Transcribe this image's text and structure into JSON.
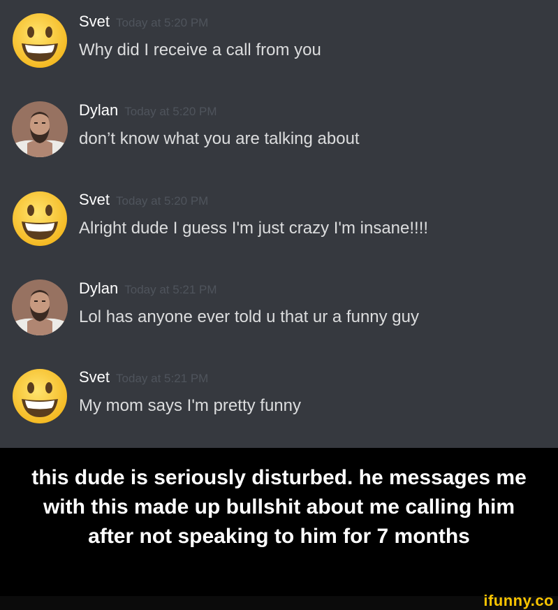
{
  "messages": [
    {
      "author": "Svet",
      "timestamp": "Today at 5:20 PM",
      "text": "Why did I receive a call from you",
      "avatar": "smiley-emoji-avatar"
    },
    {
      "author": "Dylan",
      "timestamp": "Today at 5:20 PM",
      "text": "don’t know what you are talking about",
      "avatar": "bearded-man-photo-avatar"
    },
    {
      "author": "Svet",
      "timestamp": "Today at 5:20 PM",
      "text": "Alright dude I guess I'm just crazy I'm insane!!!!",
      "avatar": "smiley-emoji-avatar"
    },
    {
      "author": "Dylan",
      "timestamp": "Today at 5:21 PM",
      "text": "Lol has anyone ever told u that ur a funny guy",
      "avatar": "bearded-man-photo-avatar"
    },
    {
      "author": "Svet",
      "timestamp": "Today at 5:21 PM",
      "text": "My mom says I'm pretty funny",
      "avatar": "smiley-emoji-avatar"
    }
  ],
  "caption": "this dude is seriously disturbed. he messages me with this made up bullshit about me calling him after not speaking to him for 7 months",
  "watermark": "ifunny.co",
  "colors": {
    "chat_background": "#36393f",
    "author_name": "#ffffff",
    "timestamp": "#4f545c",
    "message_text": "#dcddde",
    "caption_background": "#000000",
    "watermark": "#f9c400"
  }
}
